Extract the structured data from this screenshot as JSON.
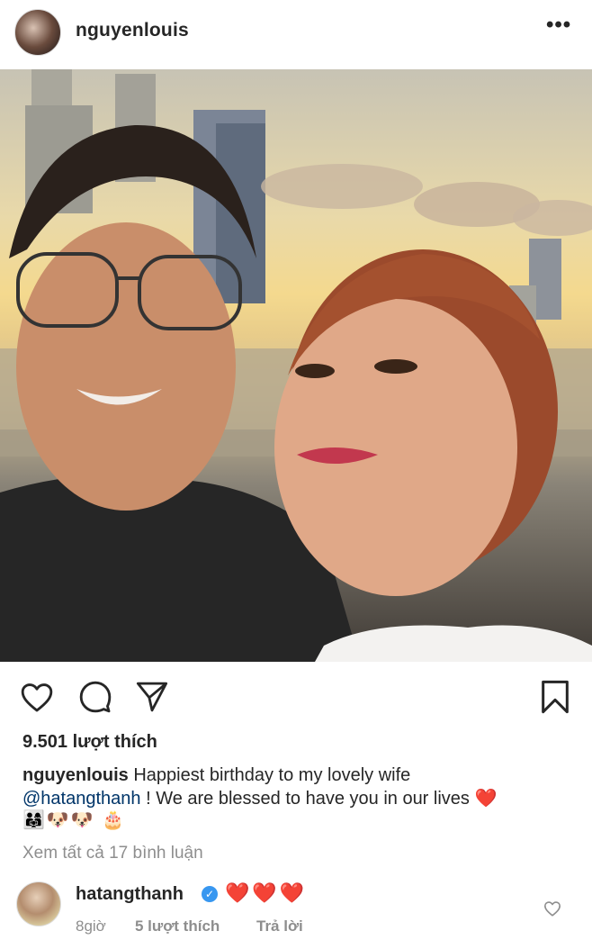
{
  "post": {
    "username": "nguyenlouis",
    "more_icon": "ellipsis-horizontal-icon",
    "likes_text": "9.501 lượt thích",
    "caption": {
      "username": "nguyenlouis",
      "text_line1": " Happiest birthday to my lovely wife",
      "mention": "@hatangthanh",
      "text_line2": " ! We are blessed to have you in our lives ❤️",
      "emoji_line": "👨‍👩‍👧🐶🐶 🎂"
    },
    "view_comments": "Xem tất cả 17 bình luận",
    "actions": {
      "like_icon": "heart-outline-icon",
      "comment_icon": "comment-bubble-icon",
      "share_icon": "paper-plane-icon",
      "save_icon": "bookmark-icon"
    }
  },
  "comment": {
    "username": "hatangthanh",
    "text": "❤️❤️❤️",
    "time": "8giờ",
    "likes": "5 lượt thích",
    "reply": "Trả lời"
  },
  "colors": {
    "text": "#262626",
    "muted": "#8e8e8e",
    "mention": "#003569",
    "verified": "#3897f0"
  }
}
